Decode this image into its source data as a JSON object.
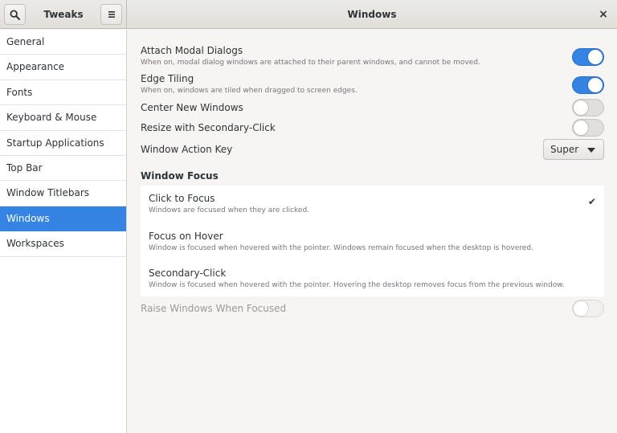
{
  "header": {
    "sidebar_title": "Tweaks",
    "page_title": "Windows",
    "search_icon": "search-icon",
    "menu_icon": "hamburger-menu-icon",
    "close_glyph": "×"
  },
  "sidebar": {
    "items": [
      {
        "label": "General"
      },
      {
        "label": "Appearance"
      },
      {
        "label": "Fonts"
      },
      {
        "label": "Keyboard & Mouse"
      },
      {
        "label": "Startup Applications"
      },
      {
        "label": "Top Bar"
      },
      {
        "label": "Window Titlebars"
      },
      {
        "label": "Windows",
        "selected": true
      },
      {
        "label": "Workspaces"
      }
    ]
  },
  "settings": {
    "attach_modal": {
      "title": "Attach Modal Dialogs",
      "subtitle": "When on, modal dialog windows are attached to their parent windows, and cannot be moved.",
      "enabled": true
    },
    "edge_tiling": {
      "title": "Edge Tiling",
      "subtitle": "When on, windows are tiled when dragged to screen edges.",
      "enabled": true
    },
    "center_new": {
      "title": "Center New Windows",
      "enabled": false
    },
    "resize_secondary": {
      "title": "Resize with Secondary-Click",
      "enabled": false
    },
    "action_key": {
      "title": "Window Action Key",
      "value": "Super"
    }
  },
  "focus": {
    "section_title": "Window Focus",
    "options": [
      {
        "title": "Click to Focus",
        "subtitle": "Windows are focused when they are clicked.",
        "checked": true
      },
      {
        "title": "Focus on Hover",
        "subtitle": "Window is focused when hovered with the pointer. Windows remain focused when the desktop is hovered.",
        "checked": false
      },
      {
        "title": "Secondary-Click",
        "subtitle": "Window is focused when hovered with the pointer. Hovering the desktop removes focus from the previous window.",
        "checked": false
      }
    ],
    "check_glyph": "✔"
  },
  "raise": {
    "title": "Raise Windows When Focused",
    "enabled": false,
    "sensitive": false
  },
  "colors": {
    "accent": "#3584e4",
    "sidebar_bg": "#ffffff",
    "window_bg": "#f6f5f4"
  }
}
